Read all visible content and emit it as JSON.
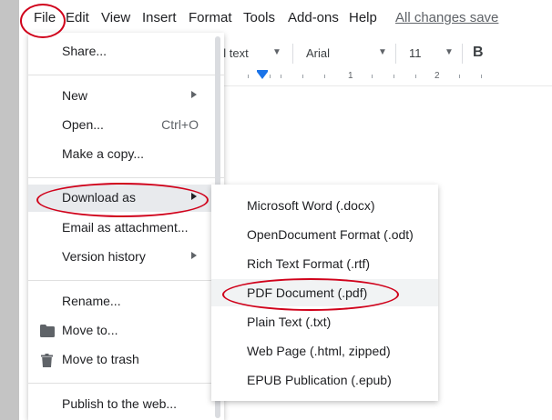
{
  "menubar": {
    "items": [
      "File",
      "Edit",
      "View",
      "Insert",
      "Format",
      "Tools",
      "Add-ons",
      "Help"
    ],
    "save_status": "All changes save"
  },
  "toolbar": {
    "style_partial": "al text",
    "font": "Arial",
    "size": "11",
    "bold": "B"
  },
  "ruler": {
    "numbers": [
      "1",
      "2"
    ]
  },
  "file_menu": {
    "items": [
      {
        "label": "Share..."
      },
      {
        "label": "New",
        "submenu": true
      },
      {
        "label": "Open...",
        "shortcut": "Ctrl+O"
      },
      {
        "label": "Make a copy..."
      },
      {
        "label": "Download as",
        "submenu": true,
        "active": true
      },
      {
        "label": "Email as attachment..."
      },
      {
        "label": "Version history",
        "submenu": true
      },
      {
        "label": "Rename..."
      },
      {
        "label": "Move to...",
        "icon": "folder-icon"
      },
      {
        "label": "Move to trash",
        "icon": "trash-icon"
      },
      {
        "label": "Publish to the web..."
      }
    ]
  },
  "download_submenu": {
    "items": [
      {
        "label": "Microsoft Word (.docx)"
      },
      {
        "label": "OpenDocument Format (.odt)"
      },
      {
        "label": "Rich Text Format (.rtf)"
      },
      {
        "label": "PDF Document (.pdf)",
        "active": true
      },
      {
        "label": "Plain Text (.txt)"
      },
      {
        "label": "Web Page (.html, zipped)"
      },
      {
        "label": "EPUB Publication (.epub)"
      }
    ]
  },
  "colors": {
    "annotation": "#d0021b",
    "ruler_marker": "#1a73e8",
    "active_item_bg": "#e8eaed"
  }
}
